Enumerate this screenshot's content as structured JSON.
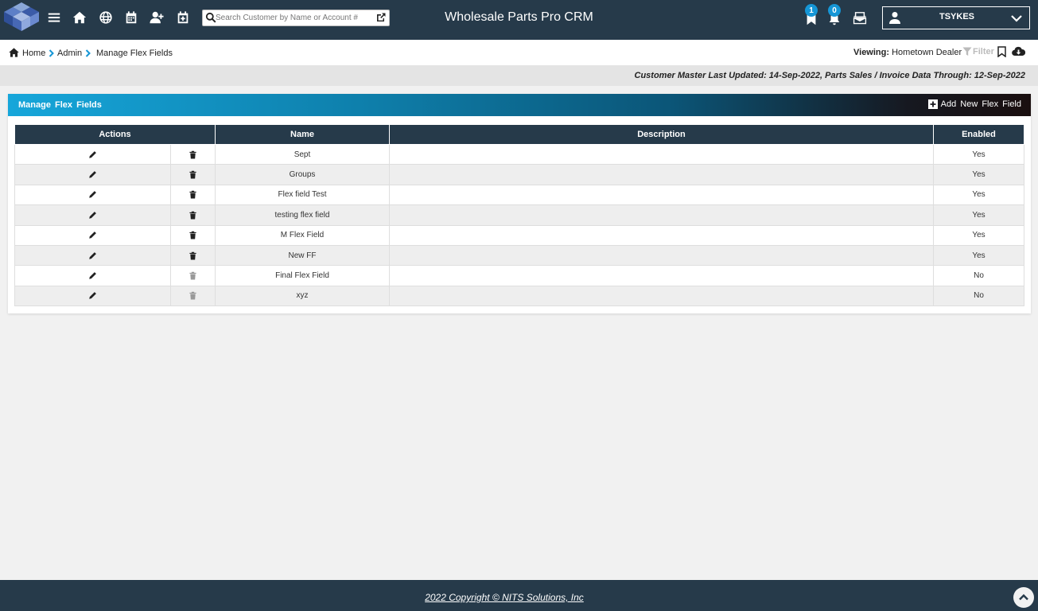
{
  "header": {
    "app_title": "Wholesale Parts Pro CRM",
    "search_placeholder": "Search Customer by Name or Account #",
    "bookmarks_count": "1",
    "notifications_count": "0",
    "user_name": "TSYKES",
    "icons": [
      "logo",
      "menu-icon",
      "home-icon",
      "globe-icon",
      "calendar-icon",
      "add-user-icon",
      "calendar-plus-icon",
      "search-icon",
      "external-link-icon",
      "bookmark-icon",
      "bell-icon",
      "mail-icon",
      "user-icon",
      "chevron-down-icon"
    ]
  },
  "breadcrumb": {
    "home": "Home",
    "admin": "Admin",
    "current": "Manage Flex Fields"
  },
  "viewing": {
    "label": "Viewing:",
    "value": "Hometown Dealer",
    "filter_label": "Filter"
  },
  "info_bar": "Customer Master Last Updated: 14-Sep-2022, Parts Sales / Invoice Data Through: 12-Sep-2022",
  "panel": {
    "title": "Manage Flex Fields",
    "add_label": "Add New Flex Field"
  },
  "table": {
    "columns": [
      "Actions",
      "Name",
      "Description",
      "Enabled"
    ],
    "rows": [
      {
        "name": "Sept",
        "description": "",
        "enabled": "Yes",
        "delete_enabled": true
      },
      {
        "name": "Groups",
        "description": "",
        "enabled": "Yes",
        "delete_enabled": true
      },
      {
        "name": "Flex field Test",
        "description": "",
        "enabled": "Yes",
        "delete_enabled": true
      },
      {
        "name": "testing flex field",
        "description": "",
        "enabled": "Yes",
        "delete_enabled": true
      },
      {
        "name": "M Flex Field",
        "description": "",
        "enabled": "Yes",
        "delete_enabled": true
      },
      {
        "name": "New FF",
        "description": "",
        "enabled": "Yes",
        "delete_enabled": true
      },
      {
        "name": "Final Flex Field",
        "description": "",
        "enabled": "No",
        "delete_enabled": false
      },
      {
        "name": "xyz",
        "description": "",
        "enabled": "No",
        "delete_enabled": false
      }
    ]
  },
  "footer": {
    "copyright": "2022 Copyright © NITS Solutions, Inc"
  },
  "colors": {
    "nav_bg": "#263a4a",
    "accent_blue": "#16a6da",
    "badge": "#1596d6",
    "page_bg": "#f1f1f1"
  }
}
